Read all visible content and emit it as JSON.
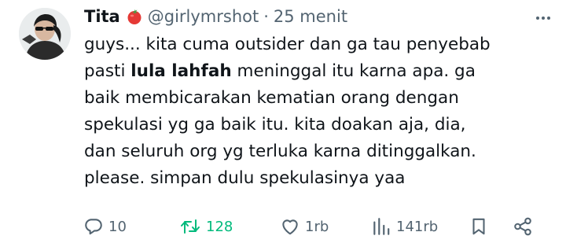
{
  "tweet": {
    "author_name": "Tita",
    "author_emoji_icon": "tomato-icon",
    "handle": "@girlymrshot",
    "separator": "·",
    "time": "25 menit",
    "lines": [
      {
        "before": "guys... kita cuma outsider dan ga tau penyebab",
        "mention": "",
        "after": ""
      },
      {
        "before": "pasti ",
        "mention": "lula lahfah",
        "after": " meninggal itu karna apa. ga"
      },
      {
        "before": "baik membicarakan kematian orang dengan",
        "mention": "",
        "after": ""
      },
      {
        "before": "spekulasi yg ga baik itu. kita doakan aja, dia,",
        "mention": "",
        "after": ""
      },
      {
        "before": "dan seluruh org yg terluka karna ditinggalkan.",
        "mention": "",
        "after": ""
      },
      {
        "before": "please. simpan dulu spekulasinya yaa",
        "mention": "",
        "after": ""
      }
    ]
  },
  "actions": {
    "reply_count": "10",
    "retweet_count": "128",
    "like_count": "1rb",
    "views_count": "141rb"
  },
  "colors": {
    "text": "#0f1419",
    "muted": "#536471",
    "retweet_active": "#00ba7c",
    "tomato": "#e53935"
  }
}
